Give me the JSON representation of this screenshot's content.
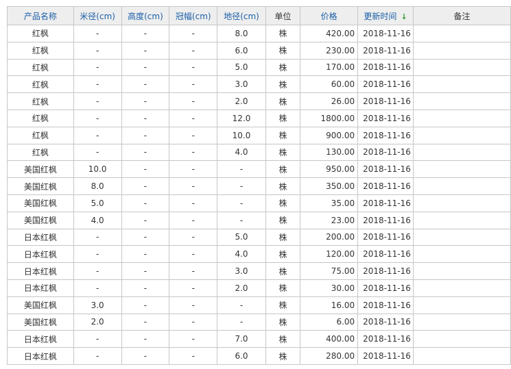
{
  "table": {
    "headers": {
      "name": "产品名称",
      "rice_diameter": "米径(cm)",
      "height": "高度(cm)",
      "crown": "冠幅(cm)",
      "ground_diameter": "地径(cm)",
      "unit": "单位",
      "price": "价格",
      "updated": "更新时间",
      "notes": "备注"
    },
    "sort_icon": "↓",
    "rows": [
      {
        "name": "红枫",
        "rice": "-",
        "height": "-",
        "crown": "-",
        "ground": "8.0",
        "unit": "株",
        "price": "420.00",
        "date": "2018-11-16",
        "note": ""
      },
      {
        "name": "红枫",
        "rice": "-",
        "height": "-",
        "crown": "-",
        "ground": "6.0",
        "unit": "株",
        "price": "230.00",
        "date": "2018-11-16",
        "note": ""
      },
      {
        "name": "红枫",
        "rice": "-",
        "height": "-",
        "crown": "-",
        "ground": "5.0",
        "unit": "株",
        "price": "170.00",
        "date": "2018-11-16",
        "note": ""
      },
      {
        "name": "红枫",
        "rice": "-",
        "height": "-",
        "crown": "-",
        "ground": "3.0",
        "unit": "株",
        "price": "60.00",
        "date": "2018-11-16",
        "note": ""
      },
      {
        "name": "红枫",
        "rice": "-",
        "height": "-",
        "crown": "-",
        "ground": "2.0",
        "unit": "株",
        "price": "26.00",
        "date": "2018-11-16",
        "note": ""
      },
      {
        "name": "红枫",
        "rice": "-",
        "height": "-",
        "crown": "-",
        "ground": "12.0",
        "unit": "株",
        "price": "1800.00",
        "date": "2018-11-16",
        "note": ""
      },
      {
        "name": "红枫",
        "rice": "-",
        "height": "-",
        "crown": "-",
        "ground": "10.0",
        "unit": "株",
        "price": "900.00",
        "date": "2018-11-16",
        "note": ""
      },
      {
        "name": "红枫",
        "rice": "-",
        "height": "-",
        "crown": "-",
        "ground": "4.0",
        "unit": "株",
        "price": "130.00",
        "date": "2018-11-16",
        "note": ""
      },
      {
        "name": "美国红枫",
        "rice": "10.0",
        "height": "-",
        "crown": "-",
        "ground": "-",
        "unit": "株",
        "price": "950.00",
        "date": "2018-11-16",
        "note": ""
      },
      {
        "name": "美国红枫",
        "rice": "8.0",
        "height": "-",
        "crown": "-",
        "ground": "-",
        "unit": "株",
        "price": "350.00",
        "date": "2018-11-16",
        "note": ""
      },
      {
        "name": "美国红枫",
        "rice": "5.0",
        "height": "-",
        "crown": "-",
        "ground": "-",
        "unit": "株",
        "price": "35.00",
        "date": "2018-11-16",
        "note": ""
      },
      {
        "name": "美国红枫",
        "rice": "4.0",
        "height": "-",
        "crown": "-",
        "ground": "-",
        "unit": "株",
        "price": "23.00",
        "date": "2018-11-16",
        "note": ""
      },
      {
        "name": "日本红枫",
        "rice": "-",
        "height": "-",
        "crown": "-",
        "ground": "5.0",
        "unit": "株",
        "price": "200.00",
        "date": "2018-11-16",
        "note": ""
      },
      {
        "name": "日本红枫",
        "rice": "-",
        "height": "-",
        "crown": "-",
        "ground": "4.0",
        "unit": "株",
        "price": "120.00",
        "date": "2018-11-16",
        "note": ""
      },
      {
        "name": "日本红枫",
        "rice": "-",
        "height": "-",
        "crown": "-",
        "ground": "3.0",
        "unit": "株",
        "price": "75.00",
        "date": "2018-11-16",
        "note": ""
      },
      {
        "name": "日本红枫",
        "rice": "-",
        "height": "-",
        "crown": "-",
        "ground": "2.0",
        "unit": "株",
        "price": "30.00",
        "date": "2018-11-16",
        "note": ""
      },
      {
        "name": "美国红枫",
        "rice": "3.0",
        "height": "-",
        "crown": "-",
        "ground": "-",
        "unit": "株",
        "price": "16.00",
        "date": "2018-11-16",
        "note": ""
      },
      {
        "name": "美国红枫",
        "rice": "2.0",
        "height": "-",
        "crown": "-",
        "ground": "-",
        "unit": "株",
        "price": "6.00",
        "date": "2018-11-16",
        "note": ""
      },
      {
        "name": "日本红枫",
        "rice": "-",
        "height": "-",
        "crown": "-",
        "ground": "7.0",
        "unit": "株",
        "price": "400.00",
        "date": "2018-11-16",
        "note": ""
      },
      {
        "name": "日本红枫",
        "rice": "-",
        "height": "-",
        "crown": "-",
        "ground": "6.0",
        "unit": "株",
        "price": "280.00",
        "date": "2018-11-16",
        "note": ""
      }
    ]
  },
  "colors": {
    "header_bg": "#eeeeee",
    "header_link": "#1a5fa8",
    "sort_icon": "#2e9b2e",
    "border": "#c6c6c6"
  }
}
